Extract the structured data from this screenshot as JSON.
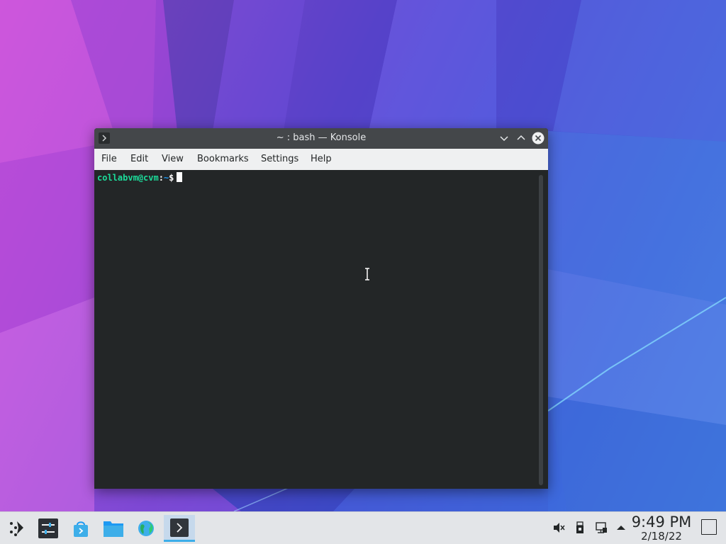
{
  "window": {
    "title": "~ : bash — Konsole",
    "app": "Konsole"
  },
  "menubar": {
    "items": [
      "File",
      "Edit",
      "View",
      "Bookmarks",
      "Settings",
      "Help"
    ]
  },
  "terminal": {
    "user_host": "collabvm@cvm",
    "colon": ":",
    "path": "~",
    "dollar": "$",
    "colors": {
      "background": "#232627",
      "user": "#1cdc9a",
      "path": "#1d99f3",
      "text": "#fcfcfc"
    }
  },
  "taskbar": {
    "launcher_icon": "plasma-launcher-icon",
    "tasks": [
      {
        "name": "system-settings",
        "icon": "settings-sliders-icon",
        "active": false
      },
      {
        "name": "discover",
        "icon": "shopping-bag-icon",
        "active": false
      },
      {
        "name": "dolphin",
        "icon": "folder-icon",
        "active": false
      },
      {
        "name": "web-browser",
        "icon": "globe-icon",
        "active": false
      },
      {
        "name": "konsole",
        "icon": "terminal-icon",
        "active": true
      }
    ],
    "tray": [
      "volume-muted-icon",
      "usb-drive-icon",
      "network-wired-icon",
      "expand-arrow-icon"
    ],
    "clock": {
      "time": "9:49 PM",
      "date": "2/18/22"
    }
  }
}
